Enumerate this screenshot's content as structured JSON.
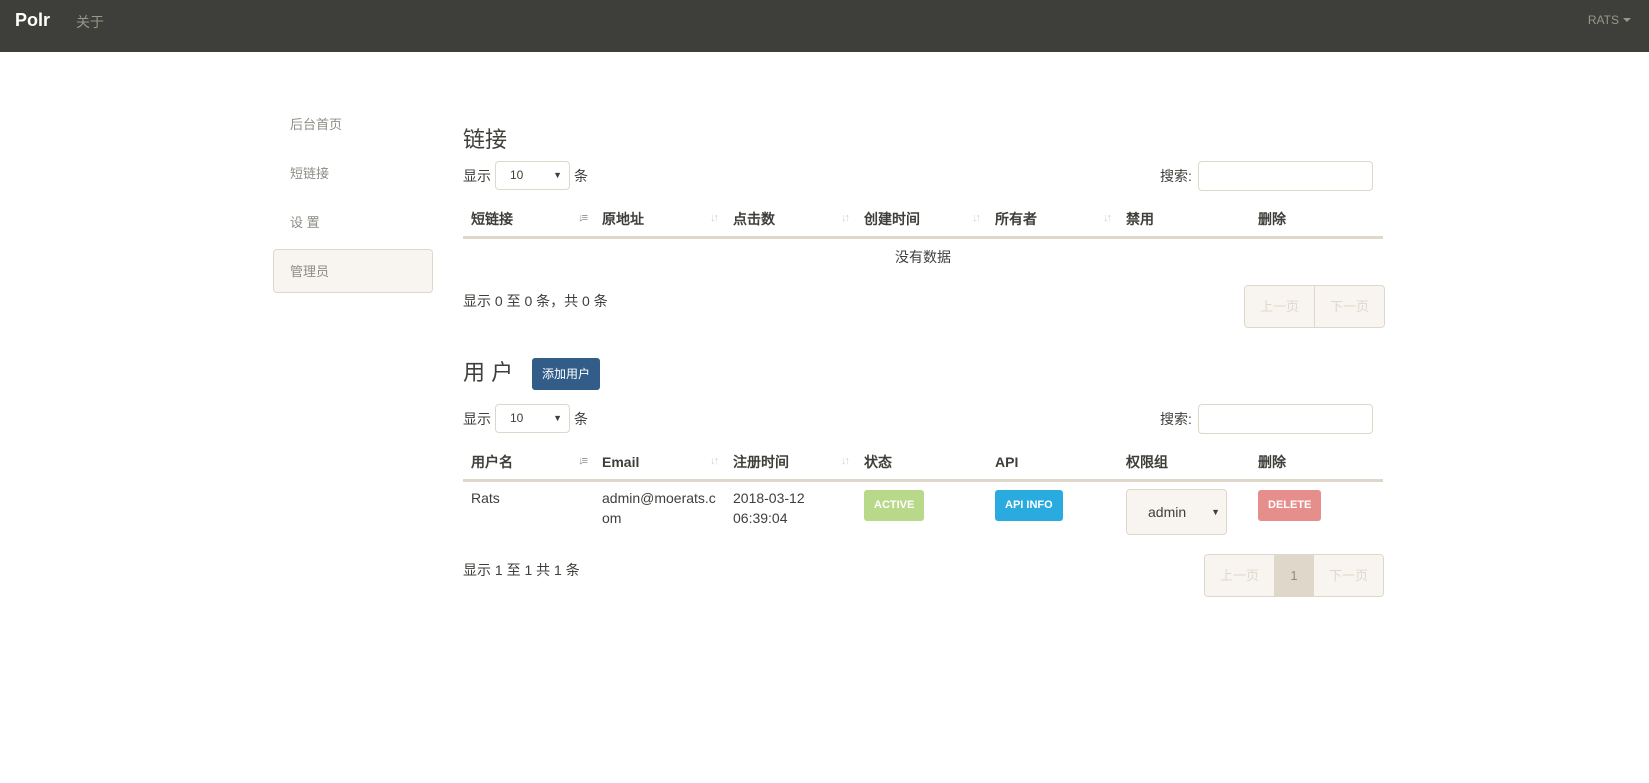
{
  "navbar": {
    "brand": "Polr",
    "about": "关于",
    "user": "RATS"
  },
  "sidebar": {
    "items": [
      {
        "label": "后台首页"
      },
      {
        "label": "短链接"
      },
      {
        "label": "设 置"
      },
      {
        "label": "管理员"
      }
    ]
  },
  "links": {
    "title": "链接",
    "show_prefix": "显示",
    "show_suffix": "条",
    "page_length": "10",
    "search_label": "搜索:",
    "columns": [
      "短链接",
      "原地址",
      "点击数",
      "创建时间",
      "所有者",
      "禁用",
      "删除"
    ],
    "empty_text": "没有数据",
    "info": "显示 0 至 0 条，共 0 条",
    "prev": "上一页",
    "next": "下一页"
  },
  "users": {
    "title": "用 户",
    "add_button": "添加用户",
    "show_prefix": "显示",
    "show_suffix": "条",
    "page_length": "10",
    "search_label": "搜索:",
    "columns": [
      "用户名",
      "Email",
      "注册时间",
      "状态",
      "API",
      "权限组",
      "删除"
    ],
    "rows": [
      {
        "username": "Rats",
        "email": "admin@moerats.com",
        "registered": "2018-03-12 06:39:04",
        "status": "ACTIVE",
        "api": "API INFO",
        "role": "admin",
        "delete": "DELETE"
      }
    ],
    "info": "显示 1 至 1 共 1 条",
    "prev": "上一页",
    "page": "1",
    "next": "下一页"
  },
  "colors": {
    "navbar": "#3e3f3a",
    "primary": "#325d88",
    "success": "#93c54b",
    "info": "#29abe0",
    "danger": "#d9534f",
    "border": "#dfd7ca"
  }
}
